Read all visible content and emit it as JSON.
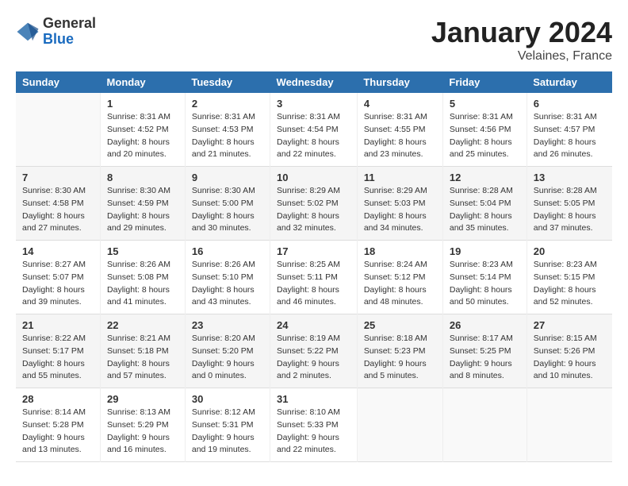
{
  "header": {
    "logo_general": "General",
    "logo_blue": "Blue",
    "month_title": "January 2024",
    "location": "Velaines, France"
  },
  "columns": [
    "Sunday",
    "Monday",
    "Tuesday",
    "Wednesday",
    "Thursday",
    "Friday",
    "Saturday"
  ],
  "weeks": [
    {
      "days": [
        {
          "num": "",
          "info": ""
        },
        {
          "num": "1",
          "info": "Sunrise: 8:31 AM\nSunset: 4:52 PM\nDaylight: 8 hours\nand 20 minutes."
        },
        {
          "num": "2",
          "info": "Sunrise: 8:31 AM\nSunset: 4:53 PM\nDaylight: 8 hours\nand 21 minutes."
        },
        {
          "num": "3",
          "info": "Sunrise: 8:31 AM\nSunset: 4:54 PM\nDaylight: 8 hours\nand 22 minutes."
        },
        {
          "num": "4",
          "info": "Sunrise: 8:31 AM\nSunset: 4:55 PM\nDaylight: 8 hours\nand 23 minutes."
        },
        {
          "num": "5",
          "info": "Sunrise: 8:31 AM\nSunset: 4:56 PM\nDaylight: 8 hours\nand 25 minutes."
        },
        {
          "num": "6",
          "info": "Sunrise: 8:31 AM\nSunset: 4:57 PM\nDaylight: 8 hours\nand 26 minutes."
        }
      ]
    },
    {
      "days": [
        {
          "num": "7",
          "info": "Sunrise: 8:30 AM\nSunset: 4:58 PM\nDaylight: 8 hours\nand 27 minutes."
        },
        {
          "num": "8",
          "info": "Sunrise: 8:30 AM\nSunset: 4:59 PM\nDaylight: 8 hours\nand 29 minutes."
        },
        {
          "num": "9",
          "info": "Sunrise: 8:30 AM\nSunset: 5:00 PM\nDaylight: 8 hours\nand 30 minutes."
        },
        {
          "num": "10",
          "info": "Sunrise: 8:29 AM\nSunset: 5:02 PM\nDaylight: 8 hours\nand 32 minutes."
        },
        {
          "num": "11",
          "info": "Sunrise: 8:29 AM\nSunset: 5:03 PM\nDaylight: 8 hours\nand 34 minutes."
        },
        {
          "num": "12",
          "info": "Sunrise: 8:28 AM\nSunset: 5:04 PM\nDaylight: 8 hours\nand 35 minutes."
        },
        {
          "num": "13",
          "info": "Sunrise: 8:28 AM\nSunset: 5:05 PM\nDaylight: 8 hours\nand 37 minutes."
        }
      ]
    },
    {
      "days": [
        {
          "num": "14",
          "info": "Sunrise: 8:27 AM\nSunset: 5:07 PM\nDaylight: 8 hours\nand 39 minutes."
        },
        {
          "num": "15",
          "info": "Sunrise: 8:26 AM\nSunset: 5:08 PM\nDaylight: 8 hours\nand 41 minutes."
        },
        {
          "num": "16",
          "info": "Sunrise: 8:26 AM\nSunset: 5:10 PM\nDaylight: 8 hours\nand 43 minutes."
        },
        {
          "num": "17",
          "info": "Sunrise: 8:25 AM\nSunset: 5:11 PM\nDaylight: 8 hours\nand 46 minutes."
        },
        {
          "num": "18",
          "info": "Sunrise: 8:24 AM\nSunset: 5:12 PM\nDaylight: 8 hours\nand 48 minutes."
        },
        {
          "num": "19",
          "info": "Sunrise: 8:23 AM\nSunset: 5:14 PM\nDaylight: 8 hours\nand 50 minutes."
        },
        {
          "num": "20",
          "info": "Sunrise: 8:23 AM\nSunset: 5:15 PM\nDaylight: 8 hours\nand 52 minutes."
        }
      ]
    },
    {
      "days": [
        {
          "num": "21",
          "info": "Sunrise: 8:22 AM\nSunset: 5:17 PM\nDaylight: 8 hours\nand 55 minutes."
        },
        {
          "num": "22",
          "info": "Sunrise: 8:21 AM\nSunset: 5:18 PM\nDaylight: 8 hours\nand 57 minutes."
        },
        {
          "num": "23",
          "info": "Sunrise: 8:20 AM\nSunset: 5:20 PM\nDaylight: 9 hours\nand 0 minutes."
        },
        {
          "num": "24",
          "info": "Sunrise: 8:19 AM\nSunset: 5:22 PM\nDaylight: 9 hours\nand 2 minutes."
        },
        {
          "num": "25",
          "info": "Sunrise: 8:18 AM\nSunset: 5:23 PM\nDaylight: 9 hours\nand 5 minutes."
        },
        {
          "num": "26",
          "info": "Sunrise: 8:17 AM\nSunset: 5:25 PM\nDaylight: 9 hours\nand 8 minutes."
        },
        {
          "num": "27",
          "info": "Sunrise: 8:15 AM\nSunset: 5:26 PM\nDaylight: 9 hours\nand 10 minutes."
        }
      ]
    },
    {
      "days": [
        {
          "num": "28",
          "info": "Sunrise: 8:14 AM\nSunset: 5:28 PM\nDaylight: 9 hours\nand 13 minutes."
        },
        {
          "num": "29",
          "info": "Sunrise: 8:13 AM\nSunset: 5:29 PM\nDaylight: 9 hours\nand 16 minutes."
        },
        {
          "num": "30",
          "info": "Sunrise: 8:12 AM\nSunset: 5:31 PM\nDaylight: 9 hours\nand 19 minutes."
        },
        {
          "num": "31",
          "info": "Sunrise: 8:10 AM\nSunset: 5:33 PM\nDaylight: 9 hours\nand 22 minutes."
        },
        {
          "num": "",
          "info": ""
        },
        {
          "num": "",
          "info": ""
        },
        {
          "num": "",
          "info": ""
        }
      ]
    }
  ]
}
